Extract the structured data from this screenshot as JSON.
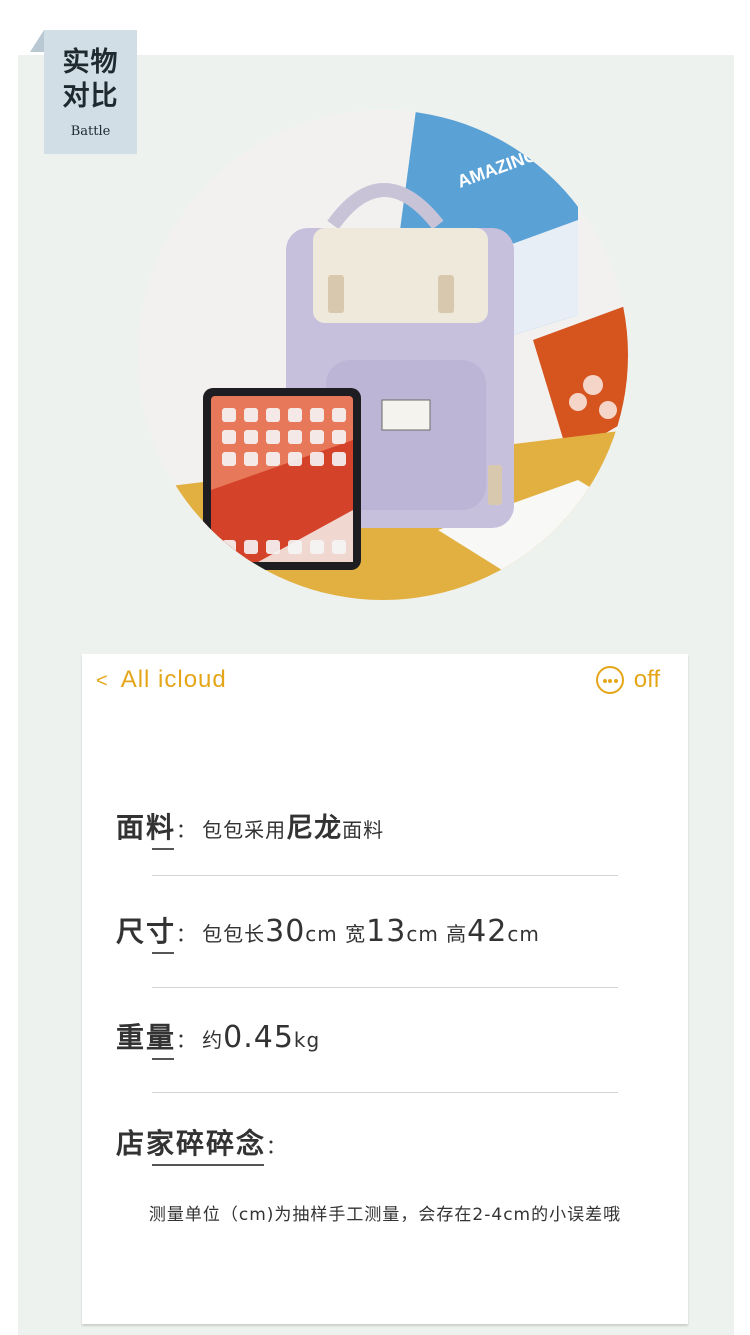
{
  "label": {
    "title": "实物\n对比",
    "subtitle": "Battle"
  },
  "header": {
    "back_label": "All icloud",
    "more_label": "off"
  },
  "specs": [
    {
      "key": "面料",
      "value_parts": [
        "包包采用",
        "尼龙",
        "面料"
      ]
    },
    {
      "key": "尺寸",
      "value_parts": [
        "包包长",
        "30",
        "cm 宽",
        "13",
        "cm 高",
        "42",
        "cm"
      ]
    },
    {
      "key": "重量",
      "value_parts": [
        "约",
        "0.45",
        "kg"
      ]
    }
  ],
  "shop_note": {
    "key": "店家碎碎念",
    "text": "测量单位（cm)为抽样手工测量，会存在2-4cm的小误差哦"
  },
  "photo": {
    "poster_text": "AMAZING"
  },
  "colors": {
    "accent": "#e4a618",
    "panel": "#eef2ee",
    "label_bg": "#d2dee6"
  }
}
